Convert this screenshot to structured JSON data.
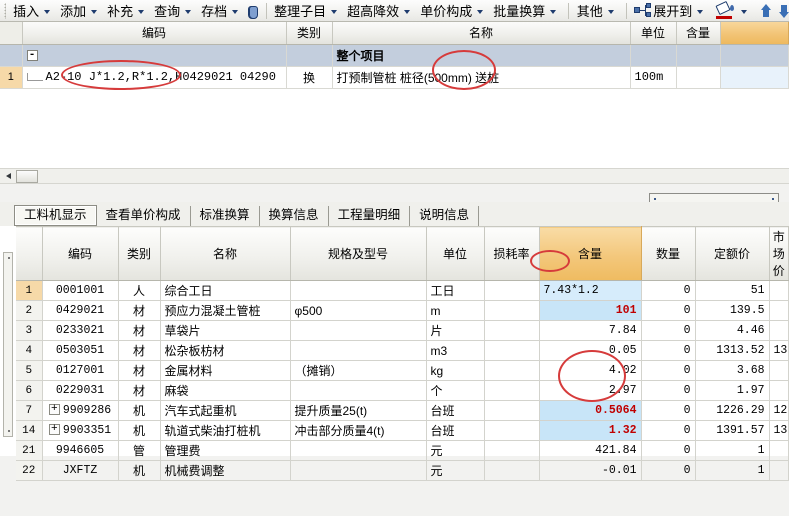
{
  "toolbar": {
    "items": [
      {
        "label": "插入",
        "has_caret": true,
        "name": "insert"
      },
      {
        "label": "添加",
        "has_caret": true,
        "name": "add"
      },
      {
        "label": "补充",
        "has_caret": true,
        "name": "supplement"
      },
      {
        "label": "查询",
        "has_caret": true,
        "name": "query"
      },
      {
        "label": "存档",
        "has_caret": true,
        "name": "archive"
      }
    ],
    "search_icon": "binoculars-icon",
    "items2": [
      {
        "label": "整理子目",
        "has_caret": true,
        "name": "organize-subitems"
      },
      {
        "label": "超高降效",
        "has_caret": true,
        "name": "height-efficiency"
      },
      {
        "label": "单价构成",
        "has_caret": true,
        "name": "unit-price-composition"
      },
      {
        "label": "批量换算",
        "has_caret": true,
        "name": "batch-conversion"
      },
      {
        "label": "其他",
        "has_caret": true,
        "name": "others"
      }
    ],
    "expand_icon": "expand-tree-icon",
    "expand_label": "展开到",
    "fill_icon": "fill-color-icon",
    "move_up_icon": "arrow-up-icon",
    "move_down_icon": "arrow-down-icon"
  },
  "top_grid": {
    "columns": [
      "",
      "编码",
      "类别",
      "名称",
      "单位",
      "含量",
      ""
    ],
    "rows": [
      {
        "type": "group",
        "rownum": "",
        "expander": "-",
        "code": "",
        "category": "",
        "name": "整个项目",
        "unit": "",
        "content": ""
      },
      {
        "type": "item",
        "rownum": "1",
        "expander": "",
        "code": "A2-10 J*1.2,R*1.2,H0429021 04290",
        "category": "换",
        "name": "打预制管桩 桩径(500mm) 送桩",
        "unit": "100m",
        "content": ""
      }
    ]
  },
  "tabs": [
    {
      "label": "工料机显示",
      "active": true
    },
    {
      "label": "查看单价构成",
      "active": false
    },
    {
      "label": "标准换算",
      "active": false
    },
    {
      "label": "换算信息",
      "active": false
    },
    {
      "label": "工程量明细",
      "active": false
    },
    {
      "label": "说明信息",
      "active": false
    }
  ],
  "bottom_grid": {
    "columns": [
      "",
      "编码",
      "类别",
      "名称",
      "规格及型号",
      "单位",
      "损耗率",
      "含量",
      "数量",
      "定额价",
      "市场价"
    ],
    "accent_column": "含量",
    "rows": [
      {
        "rownum": "1",
        "expandable": false,
        "code": "0001001",
        "category": "人",
        "name": "综合工日",
        "spec": "",
        "unit": "工日",
        "loss": "",
        "content": "7.43*1.2",
        "content_style": "edit",
        "qty": "0",
        "quota_price": "51",
        "market_price": ""
      },
      {
        "rownum": "2",
        "expandable": false,
        "code": "0429021",
        "category": "材",
        "name": "预应力混凝土管桩",
        "spec": "φ500",
        "unit": "m",
        "loss": "",
        "content": "101",
        "content_style": "sel-red",
        "qty": "0",
        "quota_price": "139.5",
        "market_price": ""
      },
      {
        "rownum": "3",
        "expandable": false,
        "code": "0233021",
        "category": "材",
        "name": "草袋片",
        "spec": "",
        "unit": "片",
        "loss": "",
        "content": "7.84",
        "content_style": "plain",
        "qty": "0",
        "quota_price": "4.46",
        "market_price": ""
      },
      {
        "rownum": "4",
        "expandable": false,
        "code": "0503051",
        "category": "材",
        "name": "松杂板枋材",
        "spec": "",
        "unit": "m3",
        "loss": "",
        "content": "0.05",
        "content_style": "plain",
        "qty": "0",
        "quota_price": "1313.52",
        "market_price": "13"
      },
      {
        "rownum": "5",
        "expandable": false,
        "code": "0127001",
        "category": "材",
        "name": "金属材料",
        "spec": "（摊销）",
        "unit": "kg",
        "loss": "",
        "content": "4.02",
        "content_style": "plain",
        "qty": "0",
        "quota_price": "3.68",
        "market_price": ""
      },
      {
        "rownum": "6",
        "expandable": false,
        "code": "0229031",
        "category": "材",
        "name": "麻袋",
        "spec": "",
        "unit": "个",
        "loss": "",
        "content": "2.97",
        "content_style": "plain",
        "qty": "0",
        "quota_price": "1.97",
        "market_price": ""
      },
      {
        "rownum": "7",
        "expandable": true,
        "code": "9909286",
        "category": "机",
        "name": "汽车式起重机",
        "spec": "提升质量25(t)",
        "unit": "台班",
        "loss": "",
        "content": "0.5064",
        "content_style": "sel-red",
        "qty": "0",
        "quota_price": "1226.29",
        "market_price": "12"
      },
      {
        "rownum": "14",
        "expandable": true,
        "code": "9903351",
        "category": "机",
        "name": "轨道式柴油打桩机",
        "spec": "冲击部分质量4(t)",
        "unit": "台班",
        "loss": "",
        "content": "1.32",
        "content_style": "sel-red",
        "qty": "0",
        "quota_price": "1391.57",
        "market_price": "13"
      },
      {
        "rownum": "21",
        "expandable": false,
        "code": "9946605",
        "category": "管",
        "name": "管理费",
        "spec": "",
        "unit": "元",
        "loss": "",
        "content": "421.84",
        "content_style": "plain",
        "qty": "0",
        "quota_price": "1",
        "market_price": ""
      },
      {
        "rownum": "22",
        "expandable": false,
        "code": "JXFTZ",
        "category": "机",
        "name": "机械费调整",
        "spec": "",
        "unit": "元",
        "loss": "",
        "content": "-0.01",
        "content_style": "plain",
        "qty": "0",
        "quota_price": "1",
        "market_price": ""
      }
    ]
  },
  "colors": {
    "accent_header": "#f3c77b",
    "selection": "#c8e5f8",
    "red_value": "#c00000",
    "annotation": "#d63b3b",
    "group_row": "#c3cedd"
  }
}
